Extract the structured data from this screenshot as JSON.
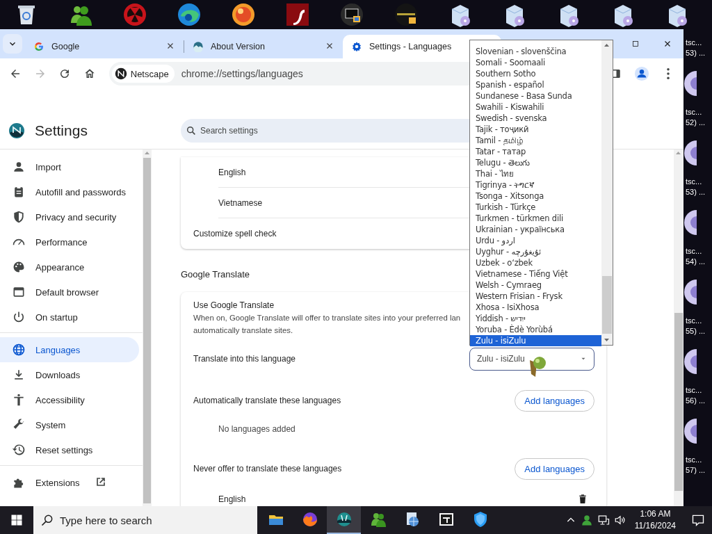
{
  "desktop": {
    "icon_labels": [
      {
        "line1": [
          "tsc..."
        ],
        "line2": [
          "53) ..."
        ]
      },
      {
        "line1": [
          "tsc..."
        ],
        "line2": [
          "52) ..."
        ]
      },
      {
        "line1": [
          "tsc..."
        ],
        "line2": [
          "53) ..."
        ]
      },
      {
        "line1": [
          "tsc..."
        ],
        "line2": [
          "54) ..."
        ]
      },
      {
        "line1": [
          "tsc..."
        ],
        "line2": [
          "55) ..."
        ]
      },
      {
        "line1": [
          "tsc..."
        ],
        "line2": [
          "56) ..."
        ]
      },
      {
        "line1": [
          "tsc..."
        ],
        "line2": [
          "57) ..."
        ]
      }
    ]
  },
  "browser": {
    "tabs": [
      {
        "title": "Google",
        "selected": false
      },
      {
        "title": "About Version",
        "selected": false
      },
      {
        "title": "Settings - Languages",
        "selected": true
      }
    ],
    "omnibox": {
      "chip": "Netscape",
      "url": "chrome://settings/languages"
    }
  },
  "settings": {
    "title": "Settings",
    "search": {
      "placeholder": "Search settings"
    },
    "sidebar": {
      "groups": [
        [
          {
            "label": "Import",
            "selected": false
          },
          {
            "label": "Autofill and passwords",
            "selected": false
          },
          {
            "label": "Privacy and security",
            "selected": false
          },
          {
            "label": "Performance",
            "selected": false
          },
          {
            "label": "Appearance",
            "selected": false
          },
          {
            "label": "Default browser",
            "selected": false
          },
          {
            "label": "On startup",
            "selected": false
          }
        ],
        [
          {
            "label": "Languages",
            "selected": true
          },
          {
            "label": "Downloads",
            "selected": false
          },
          {
            "label": "Accessibility",
            "selected": false
          },
          {
            "label": "System",
            "selected": false
          },
          {
            "label": "Reset settings",
            "selected": false
          }
        ],
        [
          {
            "label": "Extensions",
            "selected": false,
            "external": true
          }
        ]
      ]
    },
    "spell_check_languages": [
      "English",
      "Vietnamese"
    ],
    "customize_spell_check": "Customize spell check",
    "translate": {
      "heading": "Google Translate",
      "use_title": "Use Google Translate",
      "use_description": [
        "When on, Google Translate will offer to translate sites into your preferred lan",
        "automatically translate sites."
      ],
      "target_label": "Translate into this language",
      "target_value": "Zulu - isiZulu",
      "auto_label": "Automatically translate these languages",
      "auto_button": "Add languages",
      "auto_empty": "No languages added",
      "never_label": "Never offer to translate these languages",
      "never_button": "Add languages",
      "never_languages": [
        "English"
      ]
    }
  },
  "dropdown": {
    "options": [
      {
        "label": "Slovenian - slovenščina",
        "selected": false
      },
      {
        "label": "Somali - Soomaali",
        "selected": false
      },
      {
        "label": "Southern Sotho",
        "selected": false
      },
      {
        "label": "Spanish - español",
        "selected": false
      },
      {
        "label": "Sundanese - Basa Sunda",
        "selected": false
      },
      {
        "label": "Swahili - Kiswahili",
        "selected": false
      },
      {
        "label": "Swedish - svenska",
        "selected": false
      },
      {
        "label": "Tajik - тоҷикӣ",
        "selected": false
      },
      {
        "label": "Tamil - தமிழ்",
        "selected": false
      },
      {
        "label": "Tatar - татар",
        "selected": false
      },
      {
        "label": "Telugu - తెలుగు",
        "selected": false
      },
      {
        "label": "Thai - ไทย",
        "selected": false
      },
      {
        "label": "Tigrinya - ትግርኛ",
        "selected": false
      },
      {
        "label": "Tsonga - Xitsonga",
        "selected": false
      },
      {
        "label": "Turkish - Türkçe",
        "selected": false
      },
      {
        "label": "Turkmen - türkmen dili",
        "selected": false
      },
      {
        "label": "Ukrainian - українська",
        "selected": false
      },
      {
        "label": "Urdu - اردو",
        "selected": false
      },
      {
        "label": "Uyghur - ئۇيغۇرچە",
        "selected": false
      },
      {
        "label": "Uzbek - o‘zbek",
        "selected": false
      },
      {
        "label": "Vietnamese - Tiếng Việt",
        "selected": false
      },
      {
        "label": "Welsh - Cymraeg",
        "selected": false
      },
      {
        "label": "Western Frisian - Frysk",
        "selected": false
      },
      {
        "label": "Xhosa - IsiXhosa",
        "selected": false
      },
      {
        "label": "Yiddish - ייִדיש",
        "selected": false
      },
      {
        "label": "Yoruba - Èdè Yorùbá",
        "selected": false
      },
      {
        "label": "Zulu - isiZulu",
        "selected": true
      }
    ]
  },
  "taskbar": {
    "search": {
      "placeholder": "Type here to search"
    },
    "apps": [
      {
        "selected": false
      },
      {
        "selected": false
      },
      {
        "selected": true
      },
      {
        "selected": false
      },
      {
        "selected": false
      },
      {
        "selected": false
      },
      {
        "selected": false
      }
    ],
    "time": "1:06 AM",
    "date": "11/16/2024"
  }
}
